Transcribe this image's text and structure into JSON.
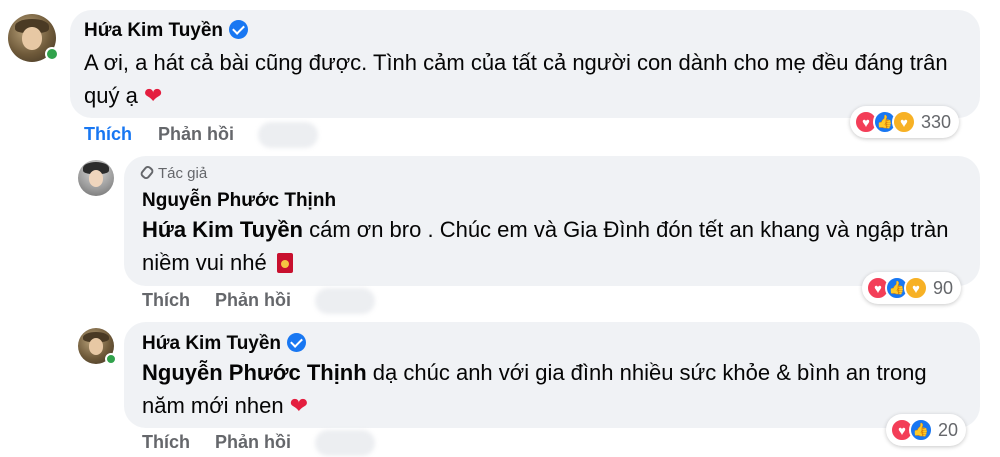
{
  "comments": [
    {
      "author": "Hứa Kim Tuyền",
      "verified": true,
      "text": "A ơi, a hát cả bài cũng được. Tình cảm của tất cả người con dành cho mẹ đều đáng trân quý ạ",
      "emoji": "❤",
      "actions": {
        "like": "Thích",
        "reply": "Phản hồi"
      },
      "reactions": {
        "icons": [
          "love",
          "like",
          "care"
        ],
        "count": "330"
      }
    },
    {
      "author_tag": "Tác giả",
      "author": "Nguyễn Phước Thịnh",
      "mention": "Hứa Kim Tuyền",
      "text": " cám ơn bro . Chúc em và Gia Đình đón tết an khang và ngập tràn niềm vui nhé",
      "actions": {
        "like": "Thích",
        "reply": "Phản hồi"
      },
      "reactions": {
        "icons": [
          "love",
          "like",
          "care"
        ],
        "count": "90"
      }
    },
    {
      "author": "Hứa Kim Tuyền",
      "verified": true,
      "mention": "Nguyễn Phước Thịnh",
      "text": " dạ chúc anh với gia đình nhiều sức khỏe & bình an trong năm mới nhen",
      "emoji": "❤",
      "actions": {
        "like": "Thích",
        "reply": "Phản hồi"
      },
      "reactions": {
        "icons": [
          "love",
          "like"
        ],
        "count": "20"
      }
    }
  ],
  "colors": {
    "bubble": "#f0f2f5",
    "link_active": "#1877f2",
    "muted": "#65676b",
    "love": "#f33e58",
    "like": "#1877f2",
    "care": "#f7b125",
    "online": "#31a24c"
  }
}
